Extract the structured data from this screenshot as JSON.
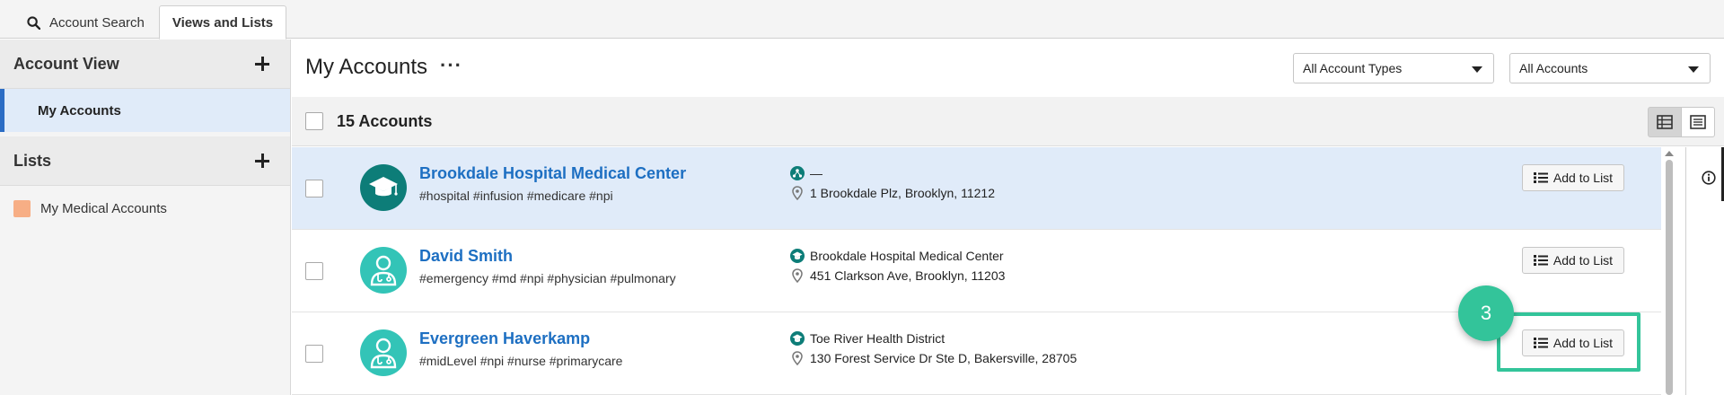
{
  "tabs": {
    "search_label": "Account Search",
    "views_label": "Views and Lists"
  },
  "sidebar": {
    "account_view_title": "Account View",
    "account_view_item": "My Accounts",
    "lists_title": "Lists",
    "list_items": [
      {
        "label": "My Medical Accounts",
        "color": "#f7ae85"
      }
    ]
  },
  "header": {
    "title": "My Accounts",
    "more_label": "···",
    "type_select": "All Account Types",
    "scope_select": "All Accounts"
  },
  "count_bar": {
    "label": "15 Accounts"
  },
  "rows": [
    {
      "name": "Brookdale Hospital Medical Center",
      "tags": "#hospital #infusion #medicare #npi",
      "affiliation": "—",
      "address": "1 Brookdale Plz, Brooklyn, 11212",
      "icon": "graduation-cap-icon",
      "button": "Add to List",
      "highlighted": true
    },
    {
      "name": "David Smith",
      "tags": "#emergency #md #npi #physician #pulmonary",
      "affiliation": "Brookdale Hospital Medical Center",
      "address": "451 Clarkson Ave, Brooklyn, 11203",
      "icon": "doctor-icon",
      "button": "Add to List",
      "highlighted": false
    },
    {
      "name": "Evergreen Haverkamp",
      "tags": "#midLevel #npi #nurse #primarycare",
      "affiliation": "Toe River Health District",
      "address": "130 Forest Service Dr Ste D, Bakersville, 28705",
      "icon": "doctor-icon",
      "button": "Add to List",
      "highlighted": false
    }
  ],
  "step_marker": {
    "number": "3",
    "color": "#33c49a"
  },
  "colors": {
    "link": "#1d6fc2",
    "highlight": "#e0ebf9",
    "accent_bar": "#2b6cc4",
    "avatar_dark": "#0d7d78",
    "avatar_light": "#33c4b7"
  }
}
